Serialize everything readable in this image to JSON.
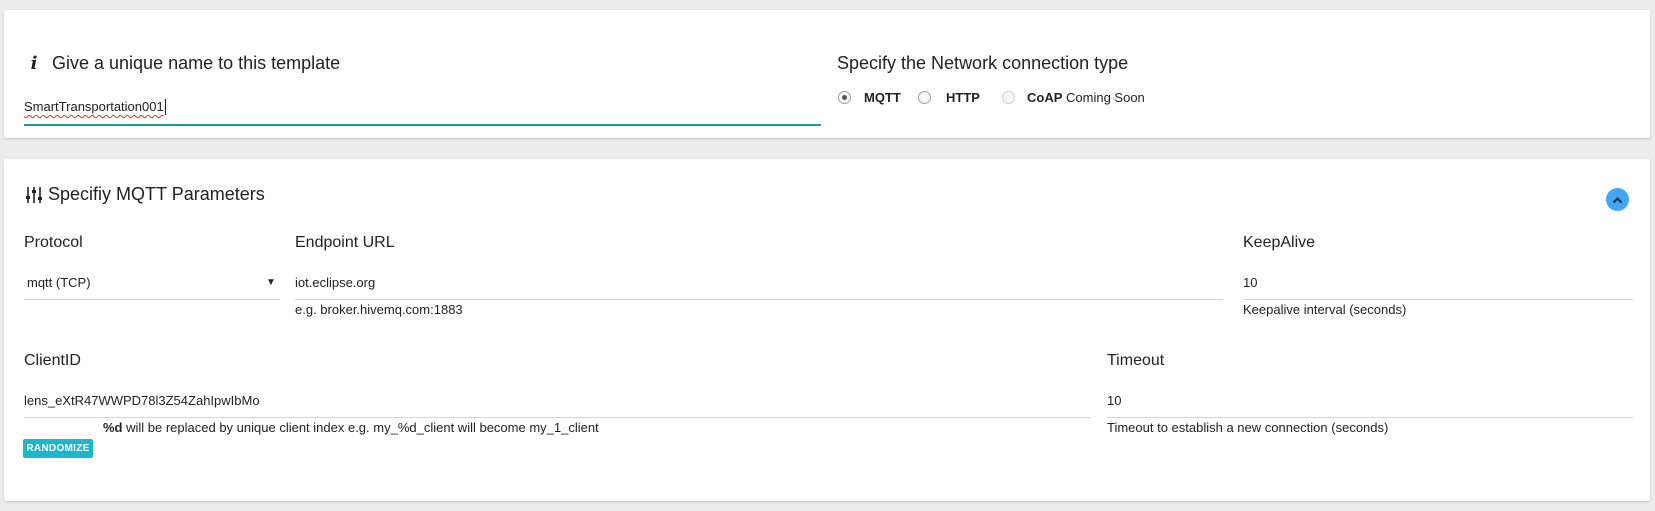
{
  "template": {
    "heading": "Give a unique name to this template",
    "name_value": "SmartTransportation001"
  },
  "network": {
    "heading": "Specify the Network connection type",
    "options": [
      {
        "label": "MQTT",
        "suffix": "",
        "state": "selected"
      },
      {
        "label": "HTTP",
        "suffix": "",
        "state": "unselected"
      },
      {
        "label": "CoAP",
        "suffix": "Coming Soon",
        "state": "disabled"
      }
    ]
  },
  "mqtt": {
    "heading": "Specifiy MQTT Parameters",
    "protocol": {
      "label": "Protocol",
      "value": "mqtt (TCP)"
    },
    "endpoint": {
      "label": "Endpoint URL",
      "value": "iot.eclipse.org",
      "helper": "e.g. broker.hivemq.com:1883"
    },
    "keepalive": {
      "label": "KeepAlive",
      "value": "10",
      "helper": "Keepalive interval (seconds)"
    },
    "clientid": {
      "label": "ClientID",
      "value": "lens_eXtR47WWPD78l3Z54ZahIpwIbMo",
      "randomize_label": "RANDOMIZE",
      "helper_bold": "%d",
      "helper_rest": " will be replaced by unique client index e.g. my_%d_client will become my_1_client"
    },
    "timeout": {
      "label": "Timeout",
      "value": "10",
      "helper": "Timeout to establish a new connection (seconds)"
    }
  },
  "icons": {
    "info": "info-icon",
    "sliders": "sliders-icon",
    "collapse": "chevron-up-icon",
    "dropdown": "dropdown-arrow-icon"
  },
  "colors": {
    "input_focus_underline": "#1a9b8d",
    "collapse_button": "#42a5f5",
    "randomize_button": "#1bb8cc",
    "page_background": "#ececec"
  }
}
